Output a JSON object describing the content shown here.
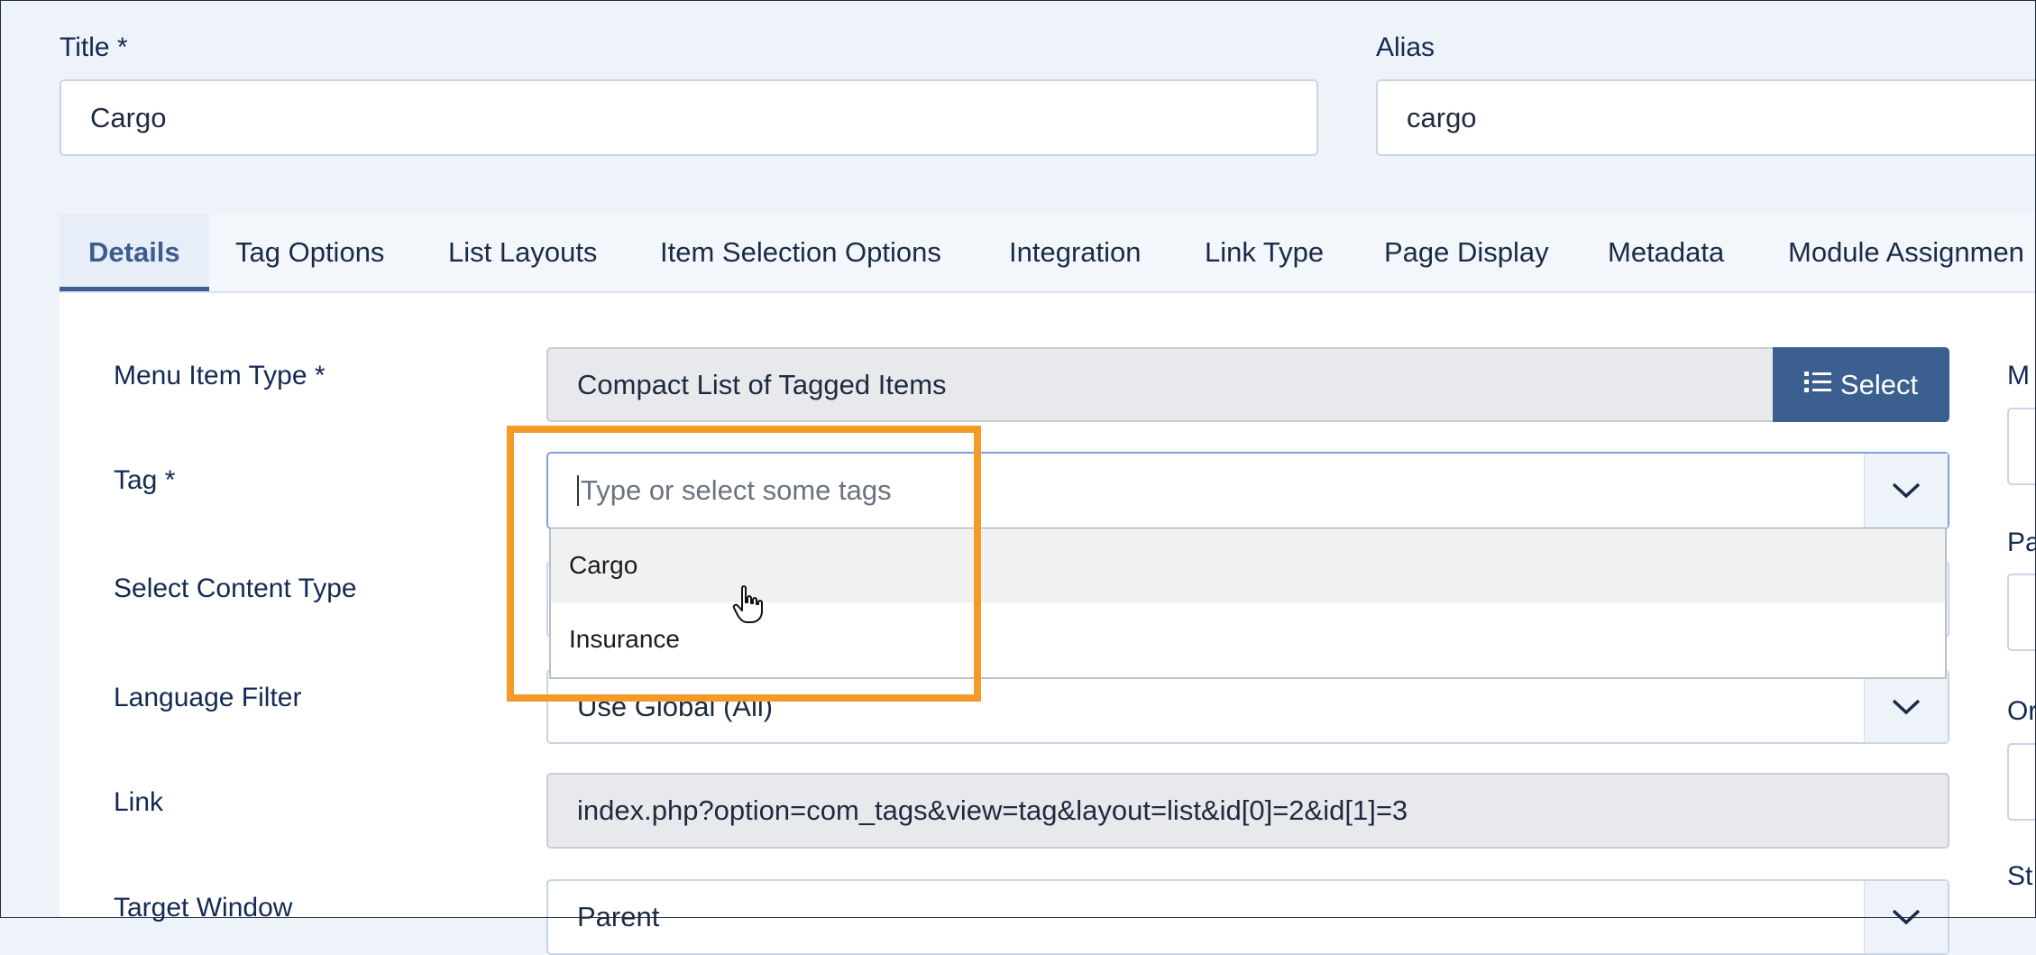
{
  "fields": {
    "title_label": "Title *",
    "title_value": "Cargo",
    "alias_label": "Alias",
    "alias_value": "cargo"
  },
  "tabs": [
    {
      "label": "Details"
    },
    {
      "label": "Tag Options"
    },
    {
      "label": "List Layouts"
    },
    {
      "label": "Item Selection Options"
    },
    {
      "label": "Integration"
    },
    {
      "label": "Link Type"
    },
    {
      "label": "Page Display"
    },
    {
      "label": "Metadata"
    },
    {
      "label": "Module Assignmen"
    }
  ],
  "form": {
    "menu_item_type_label": "Menu Item Type *",
    "menu_item_type_value": "Compact List of Tagged Items",
    "select_button": "Select",
    "tag_label": "Tag *",
    "tag_placeholder": "Type or select some tags",
    "content_type_label": "Select Content Type",
    "language_filter_label": "Language Filter",
    "language_filter_value": "Use Global (All)",
    "link_label": "Link",
    "link_value": "index.php?option=com_tags&view=tag&layout=list&id[0]=2&id[1]=3",
    "target_window_label": "Target Window",
    "target_window_value": "Parent"
  },
  "dropdown_options": [
    {
      "label": "Cargo"
    },
    {
      "label": "Insurance"
    }
  ],
  "right_column_labels": [
    "M",
    "Pa",
    "Or",
    "St"
  ],
  "colors": {
    "accent": "#3b5f8e",
    "highlight": "#f39a27"
  },
  "icons": {
    "select_button": "list-icon",
    "dropdown": "chevron-down-icon",
    "cursor": "hand-pointer-icon"
  }
}
